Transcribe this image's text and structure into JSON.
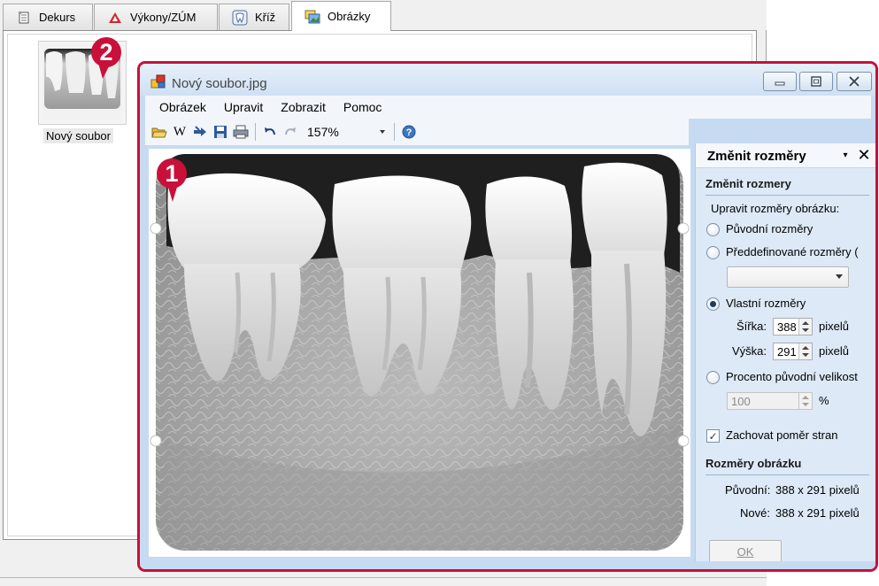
{
  "tabs": [
    {
      "label": "Dekurs",
      "icon": "notepad-icon",
      "active": false
    },
    {
      "label": "Výkony/ZÚM",
      "icon": "warning-triangle-icon",
      "active": false
    },
    {
      "label": "Kříž",
      "icon": "tooth-icon",
      "active": false
    },
    {
      "label": "Obrázky",
      "icon": "images-icon",
      "active": true
    }
  ],
  "gallery": {
    "items": [
      {
        "label": "Nový soubor"
      }
    ]
  },
  "markers": [
    "1",
    "2"
  ],
  "viewer": {
    "title": "Nový soubor.jpg",
    "window_buttons": {
      "minimize": "minimize-icon",
      "maximize": "maximize-icon",
      "close": "close-icon"
    },
    "menu": [
      "Obrázek",
      "Upravit",
      "Zobrazit",
      "Pomoc"
    ],
    "toolbar": {
      "icons": [
        "open-folder-icon",
        "word-icon",
        "send-icon",
        "save-icon",
        "print-icon",
        "undo-icon",
        "redo-icon",
        "help-icon"
      ],
      "word_glyph": "W",
      "zoom": "157%"
    },
    "panel": {
      "title": "Změnit rozměry",
      "section_resize": "Změnit rozmery",
      "subtitle": "Upravit rozměry obrázku:",
      "options": {
        "original": "Původní rozměry",
        "predefined": "Předdefinované rozměry (",
        "custom": "Vlastní rozměry",
        "percent": "Procento původní velikost"
      },
      "selected": "custom",
      "predefined_value": "",
      "width_label": "Šířka:",
      "width_value": "388",
      "height_label": "Výška:",
      "height_value": "291",
      "unit": "pixelů",
      "percent_value": "100",
      "percent_unit": "%",
      "keep_ratio_label": "Zachovat poměr stran",
      "keep_ratio_checked": true,
      "section_sizes": "Rozměry obrázku",
      "original_label": "Původní:",
      "original_value": "388 x 291 pixelů",
      "new_label": "Nové:",
      "new_value": "388 x 291 pixelů",
      "ok_label": "OK"
    }
  },
  "colors": {
    "accent_frame": "#c8103a",
    "marker": "#c8103a",
    "window_frame": "#c6dbf1",
    "panel_body": "#dde9f7"
  }
}
